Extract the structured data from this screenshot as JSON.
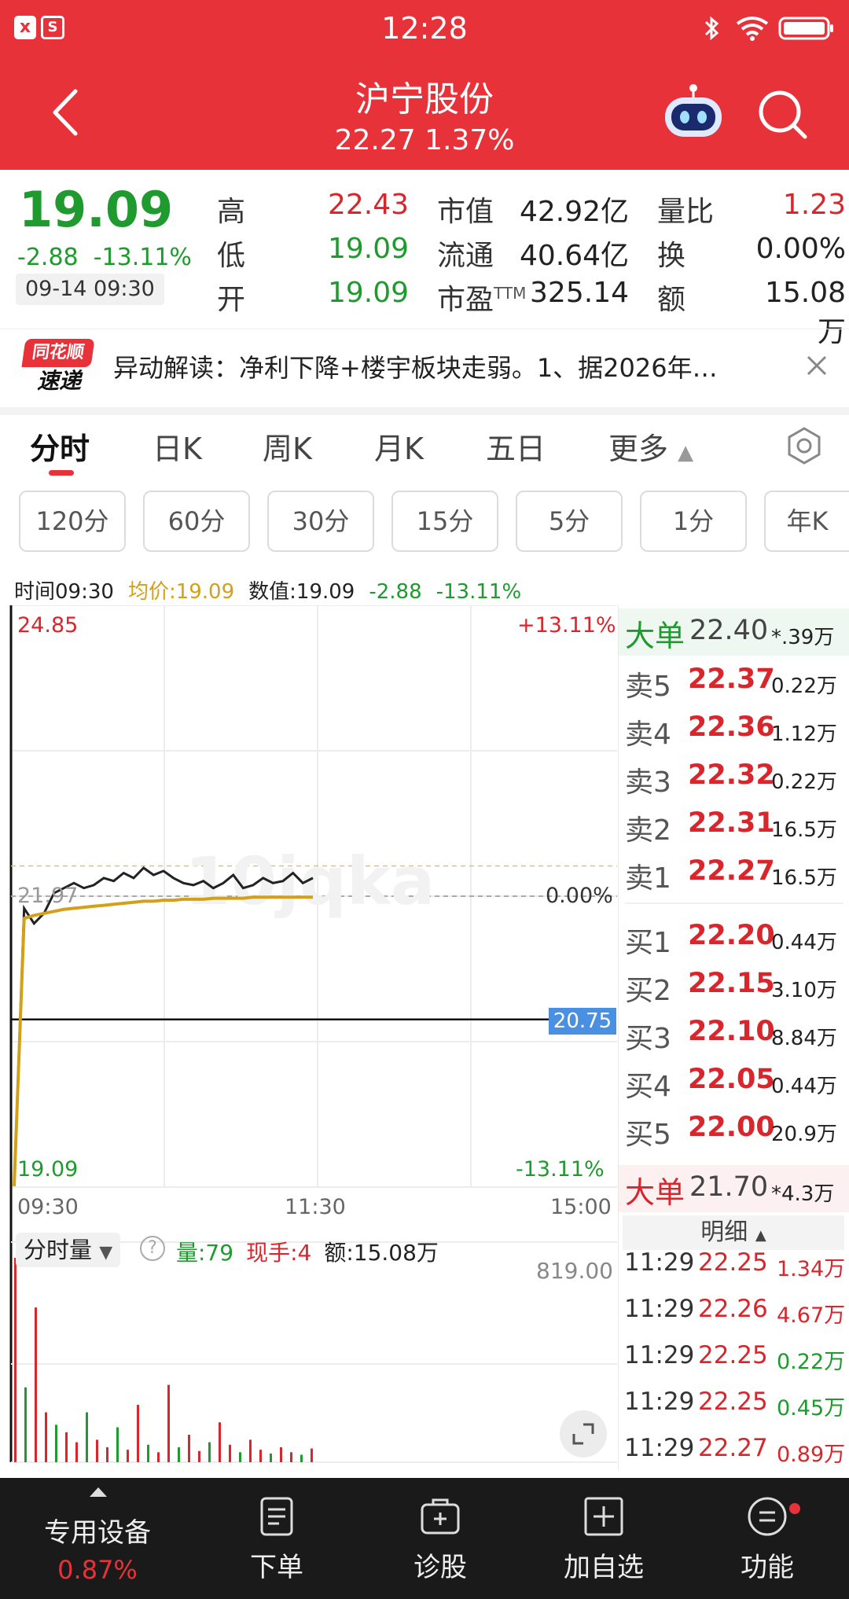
{
  "status_bar": {
    "time": "12:28",
    "icons": [
      "app-x-icon",
      "app-s-icon",
      "bluetooth-icon",
      "wifi-icon",
      "battery-icon"
    ]
  },
  "header": {
    "title": "沪宁股份",
    "subtitle": "22.27 1.37%"
  },
  "quote": {
    "price": "19.09",
    "change": "-2.88",
    "change_pct": "-13.11%",
    "datetime": "09-14 09:30",
    "stats": {
      "high_label": "高",
      "high": "22.43",
      "low_label": "低",
      "low": "19.09",
      "open_label": "开",
      "open": "19.09",
      "mktcap_label": "市值",
      "mktcap": "42.92亿",
      "float_label": "流通",
      "float": "40.64亿",
      "pe_label": "市盈",
      "pe_sup": "TTM",
      "pe": "325.14",
      "volratio_label": "量比",
      "volratio": "1.23",
      "turnover_label": "换",
      "turnover": "0.00%",
      "amount_label": "额",
      "amount": "15.08万"
    }
  },
  "news": {
    "logo_top": "同花顺",
    "logo_bottom": "速递",
    "text": "异动解读：净利下降+楼宇板块走弱。1、据2026年…"
  },
  "tabs": [
    "分时",
    "日K",
    "周K",
    "月K",
    "五日",
    "更多"
  ],
  "chips": [
    "120分",
    "60分",
    "30分",
    "15分",
    "5分",
    "1分",
    "年K"
  ],
  "info_line": {
    "time": "时间09:30",
    "avg": "均价:19.09",
    "value": "数值:19.09",
    "chg": "-2.88",
    "pct": "-13.11%"
  },
  "chart": {
    "y_top_label": "24.85",
    "y_top_pct": "+13.11%",
    "y_mid_label": "21.97",
    "y_mid_pct": "0.00%",
    "y_bot_label": "19.09",
    "y_bot_pct": "-13.11%",
    "crosshair_price": "20.75",
    "x_labels": [
      "09:30",
      "11:30",
      "15:00"
    ],
    "watermark": "10jqka"
  },
  "chart_data": {
    "type": "line",
    "title": "",
    "ylim": [
      19.09,
      24.85
    ],
    "prev_close": 21.97,
    "x_range": [
      "09:30",
      "15:00"
    ],
    "series": [
      {
        "name": "",
        "values": [
          19.1,
          21.85,
          21.7,
          21.8,
          22.0,
          22.05,
          22.1,
          22.05,
          22.08,
          22.15,
          22.12,
          22.2,
          22.15,
          22.25,
          22.18,
          22.22,
          22.15,
          22.1,
          22.08,
          22.12,
          22.05,
          22.1,
          22.18,
          22.05,
          22.08,
          22.15,
          22.1,
          22.12,
          22.2,
          22.1,
          22.15
        ]
      },
      {
        "name": "均价",
        "values": [
          19.1,
          21.75,
          21.78,
          21.8,
          21.82,
          21.84,
          21.85,
          21.86,
          21.87,
          21.88,
          21.89,
          21.9,
          21.91,
          21.92,
          21.92,
          21.93,
          21.93,
          21.94,
          21.94,
          21.94,
          21.95,
          21.95,
          21.95,
          21.95,
          21.96,
          21.96,
          21.96,
          21.96,
          21.96,
          21.96,
          21.96
        ]
      }
    ],
    "volume": [
      819,
      300,
      620,
      200,
      150,
      120,
      80,
      200,
      90,
      60,
      140,
      50,
      230,
      70,
      40,
      310,
      60,
      110,
      45,
      80,
      160,
      70,
      40,
      90,
      50,
      35,
      60,
      40,
      30,
      55
    ]
  },
  "volume_panel": {
    "selector": "分时量",
    "qty": "量:79",
    "hand": "现手:4",
    "amount": "额:15.08万",
    "max": "819.00"
  },
  "order_book": {
    "big_sell": {
      "label": "大单",
      "price": "22.40",
      "vol": "*.39万"
    },
    "asks": [
      {
        "label": "卖5",
        "price": "22.37",
        "vol": "0.22万"
      },
      {
        "label": "卖4",
        "price": "22.36",
        "vol": "1.12万"
      },
      {
        "label": "卖3",
        "price": "22.32",
        "vol": "0.22万"
      },
      {
        "label": "卖2",
        "price": "22.31",
        "vol": "16.5万"
      },
      {
        "label": "卖1",
        "price": "22.27",
        "vol": "16.5万"
      }
    ],
    "bids": [
      {
        "label": "买1",
        "price": "22.20",
        "vol": "0.44万"
      },
      {
        "label": "买2",
        "price": "22.15",
        "vol": "3.10万"
      },
      {
        "label": "买3",
        "price": "22.10",
        "vol": "8.84万"
      },
      {
        "label": "买4",
        "price": "22.05",
        "vol": "0.44万"
      },
      {
        "label": "买5",
        "price": "22.00",
        "vol": "20.9万"
      }
    ],
    "big_buy": {
      "label": "大单",
      "price": "21.70",
      "vol": "*4.3万"
    },
    "detail_label": "明细"
  },
  "ticks": [
    {
      "time": "11:29",
      "price": "22.25",
      "vol": "1.34万",
      "color": "#d9262c"
    },
    {
      "time": "11:29",
      "price": "22.26",
      "vol": "4.67万",
      "color": "#d9262c"
    },
    {
      "time": "11:29",
      "price": "22.25",
      "vol": "0.22万",
      "color": "#1e9a2e"
    },
    {
      "time": "11:29",
      "price": "22.25",
      "vol": "0.45万",
      "color": "#1e9a2e"
    },
    {
      "time": "11:29",
      "price": "22.27",
      "vol": "0.89万",
      "color": "#d9262c"
    }
  ],
  "bottom_nav": {
    "device": {
      "label": "专用设备",
      "sub": "0.87%"
    },
    "order": "下单",
    "diagnose": "诊股",
    "add": "加自选",
    "func": "功能"
  },
  "colors": {
    "brand": "#e8323a",
    "up": "#d9262c",
    "down": "#1e9a2e",
    "avg": "#d4a017",
    "crosshair_tag": "#4a90e2"
  }
}
